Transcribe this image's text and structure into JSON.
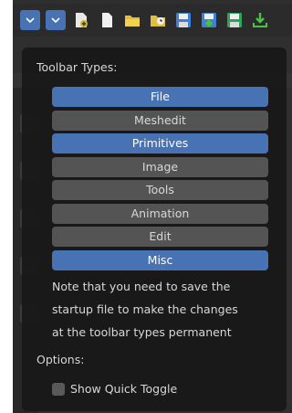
{
  "toolbar": {
    "icons": [
      "chevron-down-icon",
      "chevron-down-icon",
      "new-file-icon",
      "blank-file-icon",
      "open-folder-icon",
      "recent-folder-icon",
      "save-icon",
      "save-as-icon",
      "save-copy-icon",
      "import-icon"
    ]
  },
  "popup": {
    "heading": "Toolbar Types:",
    "types": [
      {
        "label": "File",
        "selected": true
      },
      {
        "label": "Meshedit",
        "selected": false
      },
      {
        "label": "Primitives",
        "selected": true
      },
      {
        "label": "Image",
        "selected": false
      },
      {
        "label": "Tools",
        "selected": false
      },
      {
        "label": "Animation",
        "selected": false
      },
      {
        "label": "Edit",
        "selected": false
      },
      {
        "label": "Misc",
        "selected": true
      }
    ],
    "note_lines": [
      "Note that you need to save the",
      "startup file to make the changes",
      "at the toolbar types permanent"
    ],
    "options_label": "Options:",
    "quick_toggle_label": "Show Quick Toggle",
    "quick_toggle_checked": false
  },
  "colors": {
    "accent": "#4772b3",
    "button": "#545454",
    "popup_bg": "#181818"
  }
}
